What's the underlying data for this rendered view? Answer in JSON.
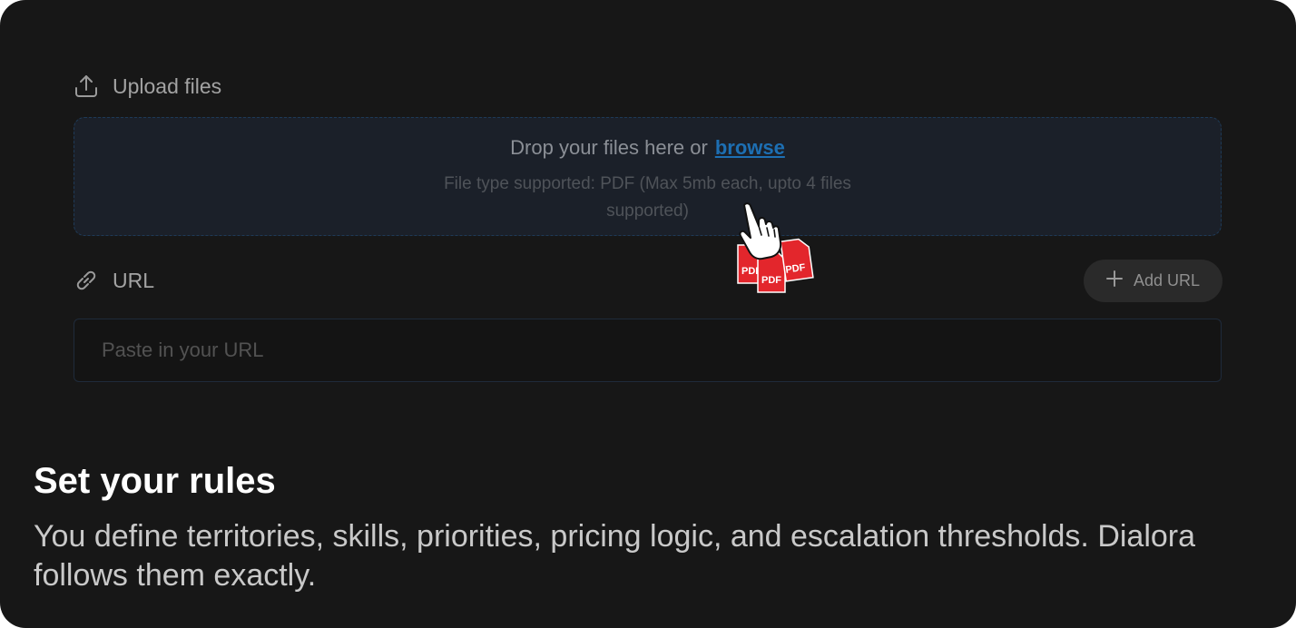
{
  "upload": {
    "label": "Upload files",
    "icon": "upload-icon",
    "drop_text": "Drop your files here or",
    "browse_label": "browse",
    "hint": "File type supported: PDF (Max 5mb each, upto 4 files supported)",
    "pdf_badges": [
      "PDF",
      "PDF",
      "PDF"
    ]
  },
  "url": {
    "label": "URL",
    "icon": "link-icon",
    "add_button_label": "Add URL",
    "add_button_icon": "plus-icon",
    "placeholder": "Paste in your URL"
  },
  "caption": {
    "title": "Set your rules",
    "description": "You define territories, skills, priorities, pricing logic, and escalation thresholds. Dialora follows them exactly."
  },
  "colors": {
    "background": "#171717",
    "link": "#1d6fb3",
    "pdf_red": "#e3262c",
    "dropzone_border": "#1e3a57"
  }
}
